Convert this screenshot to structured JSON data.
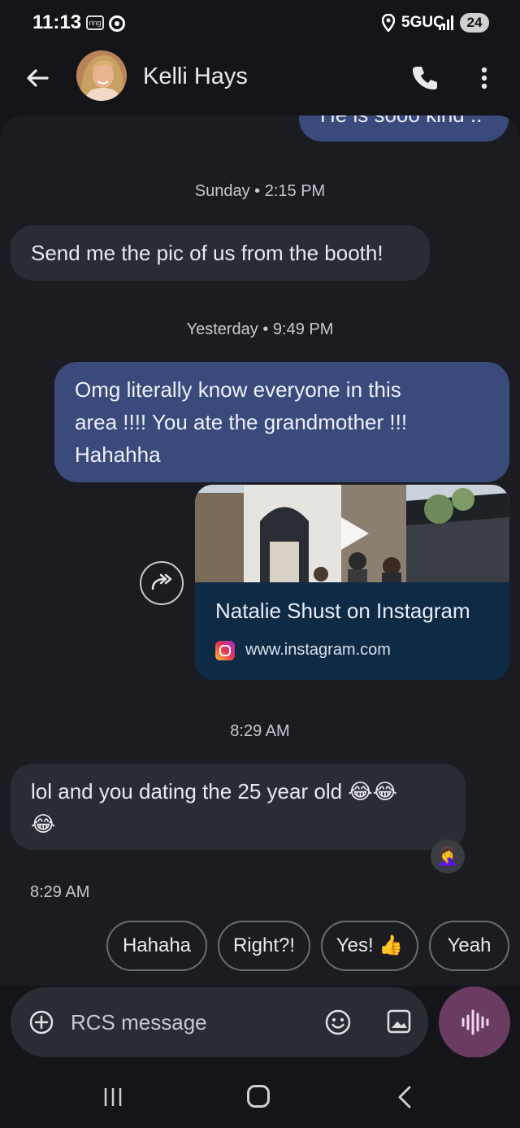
{
  "status_bar": {
    "time": "11:13",
    "ring_badge": "ring",
    "network": "5GUC",
    "battery": "24"
  },
  "header": {
    "contact_name": "Kelli Hays",
    "back_icon": "arrow-left-icon",
    "call_icon": "phone-icon",
    "more_icon": "more-vert-icon"
  },
  "conversation": {
    "partial_top_message": "He is sooo kind ..",
    "groups": [
      {
        "timestamp": "Sunday • 2:15 PM",
        "messages": [
          {
            "direction": "incoming",
            "text": "Send me the pic of us from the booth!"
          }
        ]
      },
      {
        "timestamp": "Yesterday • 9:49 PM",
        "messages": [
          {
            "direction": "outgoing",
            "lines": [
              "Omg literally know everyone in this",
              "area !!!! You ate the grandmother !!!",
              "Hahahha"
            ]
          },
          {
            "direction": "outgoing",
            "type": "link_preview",
            "title": "Natalie Shust on Instagram",
            "url": "www.instagram.com",
            "icon": "instagram-icon",
            "share_icon": "share-forward-icon"
          }
        ]
      },
      {
        "timestamp": "8:29 AM",
        "messages": [
          {
            "direction": "incoming",
            "lines": [
              "lol and you dating the 25 year old 😂😂",
              "😂"
            ],
            "reaction": "🤦‍♀️"
          }
        ]
      }
    ],
    "last_timestamp": "8:29 AM"
  },
  "smart_replies": [
    "Hahaha",
    "Right?!",
    "Yes! 👍",
    "Yeah"
  ],
  "compose": {
    "placeholder": "RCS message",
    "value": ""
  },
  "colors": {
    "background": "#141519",
    "panel": "#1b1c22",
    "incoming_bubble": "#2a2c33",
    "outgoing_bubble": "#3a4a7a",
    "link_card": "#0f2a44",
    "voice_button": "#6b3c62"
  }
}
